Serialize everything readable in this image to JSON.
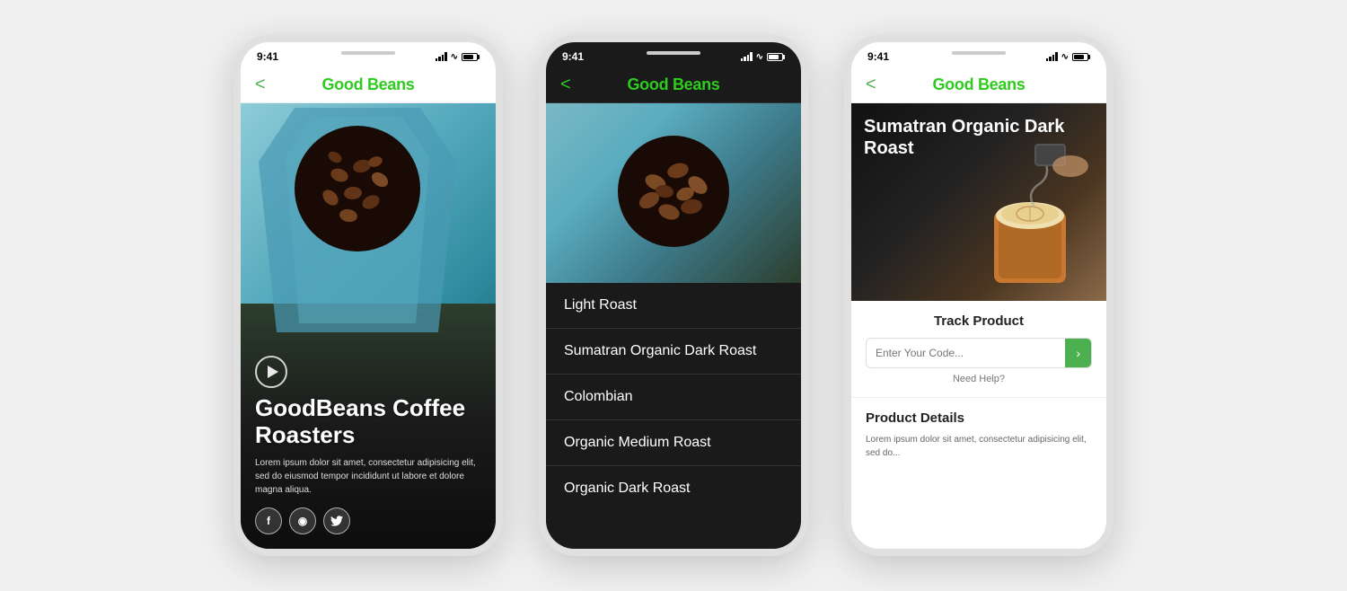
{
  "app": {
    "name": "Good Beans",
    "brand_color": "#2ecc1e",
    "accent_color": "#4caf50"
  },
  "status_bar": {
    "time": "9:41"
  },
  "phone1": {
    "nav": {
      "back": "<",
      "title": "Good Beans"
    },
    "hero": {
      "title": "GoodBeans Coffee Roasters",
      "body": "Lorem ipsum dolor sit amet, consectetur adipisicing elit, sed do eiusmod tempor incididunt ut labore et dolore magna aliqua.",
      "play_label": "play"
    },
    "social": {
      "facebook": "f",
      "instagram": "◉",
      "twitter": "t"
    }
  },
  "phone2": {
    "nav": {
      "back": "<",
      "title": "Good Beans"
    },
    "menu_items": [
      "Light Roast",
      "Sumatran Organic Dark Roast",
      "Colombian",
      "Organic Medium Roast",
      "Organic Dark Roast"
    ]
  },
  "phone3": {
    "nav": {
      "back": "<",
      "title": "Good Beans"
    },
    "product": {
      "title": "Sumatran Organic Dark Roast",
      "track_title": "Track Product",
      "track_placeholder": "Enter Your Code...",
      "track_button": "›",
      "need_help": "Need Help?",
      "details_title": "Product Details",
      "details_body": "Lorem ipsum dolor sit amet, consectetur adipisicing elit, sed do..."
    }
  }
}
